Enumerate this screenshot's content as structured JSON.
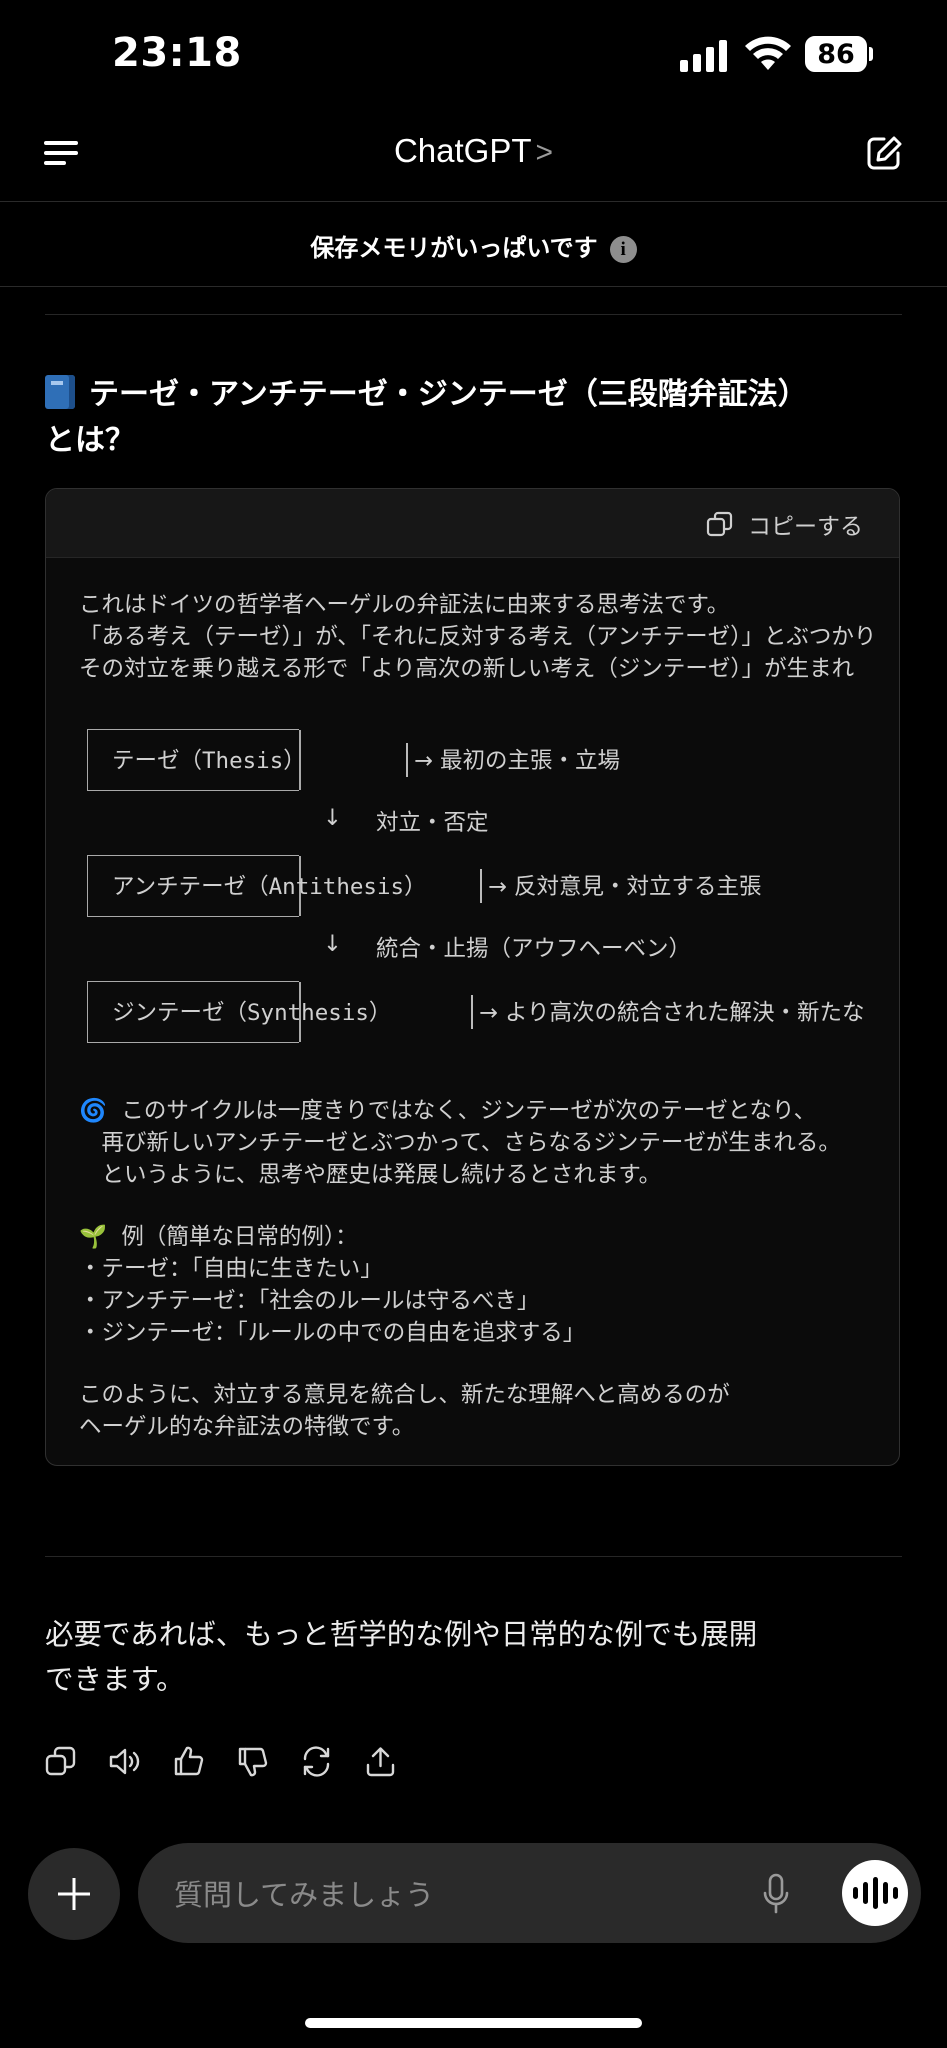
{
  "status": {
    "time": "23:18",
    "battery": "86"
  },
  "nav": {
    "title": "ChatGPT",
    "title_chevron": ">"
  },
  "banner": {
    "text": "保存メモリがいっぱいです",
    "info_glyph": "i"
  },
  "heading": {
    "line1": "テーゼ・アンチテーゼ・ジンテーゼ（三段階弁証法）",
    "line2": "とは？"
  },
  "code_block": {
    "copy_label": "コピーする",
    "intro": [
      "これはドイツの哲学者ヘーゲルの弁証法に由来する思考法です。",
      "「ある考え（テーゼ）」が、「それに反対する考え（アンチテーゼ）」とぶつかり",
      "その対立を乗り越える形で「より高次の新しい考え（ジンテーゼ）」が生まれ"
    ],
    "diagram": {
      "thesis_label": "テーゼ（Thesis）",
      "thesis_desc": "→ 最初の主張・立場",
      "arrow1": "↓",
      "arrow1_text": "対立・否定",
      "antithesis_label": "アンチテーゼ（Antithesis）",
      "antithesis_desc": "→ 反対意見・対立する主張",
      "arrow2": "↓",
      "arrow2_text": "統合・止揚（アウフヘーベン）",
      "synthesis_label": "ジンテーゼ（Synthesis）",
      "synthesis_desc": "→ より高次の統合された解決・新たな"
    },
    "cycle": [
      "🌀  このサイクルは一度きりではなく、ジンテーゼが次のテーゼとなり、",
      "　再び新しいアンチテーゼとぶつかって、さらなるジンテーゼが生まれる。",
      "　というように、思考や歴史は発展し続けるとされます。"
    ],
    "example": [
      "🌱  例（簡単な日常的例）：",
      "・テーゼ：「自由に生きたい」",
      "・アンチテーゼ：「社会のルールは守るべき」",
      "・ジンテーゼ：「ルールの中での自由を追求する」"
    ],
    "outro": [
      "このように、対立する意見を統合し、新たな理解へと高めるのが",
      "ヘーゲル的な弁証法の特徴です。"
    ]
  },
  "answer": {
    "line1": "必要であれば、もっと哲学的な例や日常的な例でも展開",
    "line2": "できます。"
  },
  "actions": [
    "copy-icon",
    "speaker-icon",
    "thumbs-up-icon",
    "thumbs-down-icon",
    "regenerate-icon",
    "share-icon"
  ],
  "composer": {
    "placeholder": "質問してみましょう"
  }
}
